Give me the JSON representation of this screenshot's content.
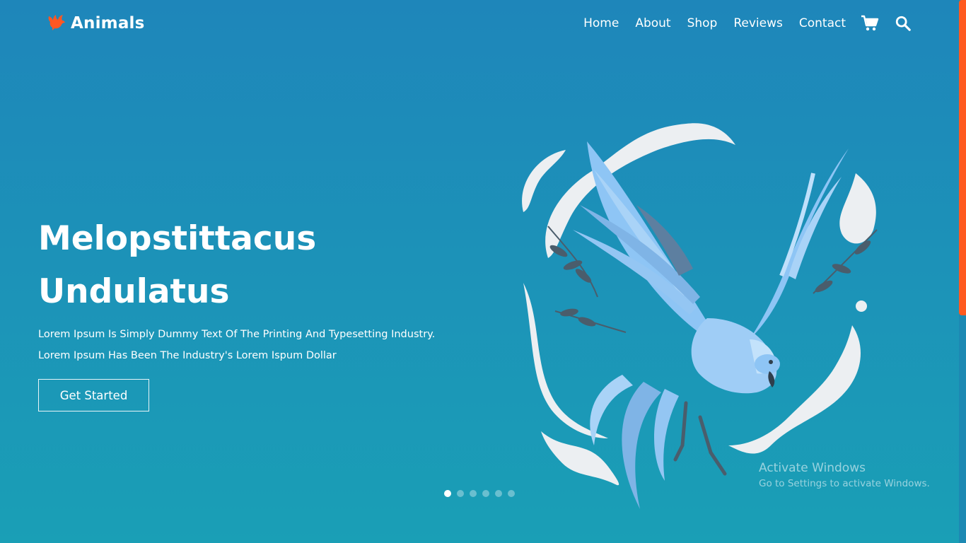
{
  "brand": {
    "name": "Animals",
    "icon": "bird-icon",
    "icon_color": "#ff5722"
  },
  "nav": {
    "items": [
      "Home",
      "About",
      "Shop",
      "Reviews",
      "Contact"
    ],
    "cart_icon": "cart-icon",
    "search_icon": "search-icon"
  },
  "hero": {
    "title_line1": "Melopstittacus",
    "title_line2": "Undulatus",
    "desc_line1": "Lorem Ipsum Is Simply Dummy Text Of The Printing And Typesetting Industry.",
    "desc_line2": "Lorem Ipsum Has Been The Industry's Lorem Ispum Dollar",
    "cta_label": "Get Started",
    "illustration_icon": "phoenix-bird-illustration"
  },
  "carousel": {
    "slide_count": 6,
    "active_index": 0
  },
  "watermark": {
    "title": "Activate Windows",
    "subtitle": "Go to Settings to activate Windows."
  },
  "colors": {
    "background_top": "#1e86ba",
    "background_bottom": "#1a9fb6",
    "accent": "#ff5722",
    "scrollbar_thumb": "#ff5a1f"
  }
}
